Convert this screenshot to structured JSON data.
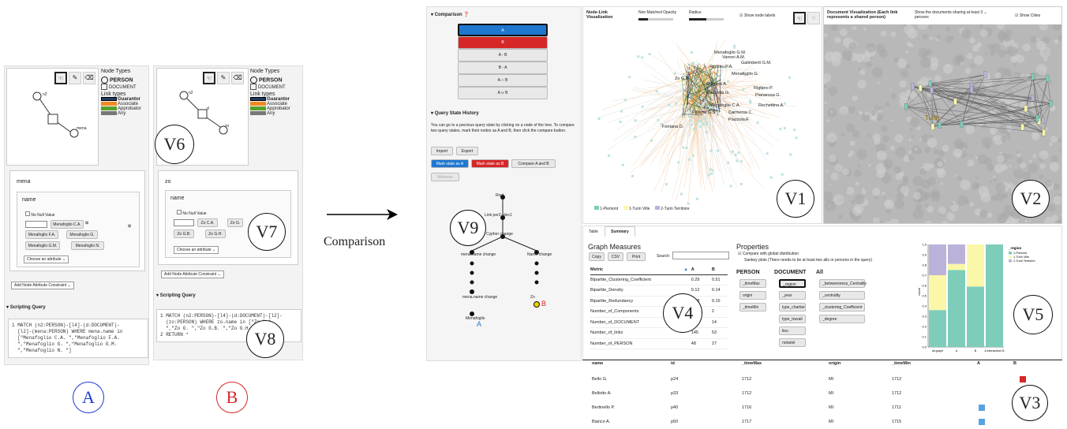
{
  "panelA": {
    "node_types_title": "Node Types",
    "type_person": "PERSON",
    "type_document": "DOCUMENT",
    "link_types_title": "Link types",
    "links": [
      "Guarantor",
      "Associate",
      "Approbator",
      "Any"
    ],
    "node_n2": "n2",
    "node_mena": "mena",
    "attr_name": "mena",
    "attr_field": "name",
    "no_null": "No Null Value",
    "chips": [
      "Menafoglio C.A.",
      "Menafoglio F.A.",
      "Menafoglio G.",
      "Menafoglio G.M.",
      "Menafoglio N."
    ],
    "choose": "Choose an attribute",
    "add_constraint": "Add Node Attribute Constraint",
    "scripting": "Scripting Query",
    "code": "1 MATCH (n2:PERSON)-[l4]-(d:DOCUMENT)-\n  [l2]-(mena:PERSON) WHERE mena.name in\n  [\"Menafoglio C.A. \",\"Menafoglio F.A.\n  \",\"Menafoglio G. \",\"Menafoglio G.M.\n  \",\"Menafoglio N. \"]",
    "label": "A"
  },
  "panelB": {
    "node_n2": "n2",
    "node_d": "d",
    "node_zo": "zo",
    "attr_name": "zo",
    "attr_field": "name",
    "no_null": "No Null Value",
    "chips": [
      "Zo C.A.",
      "Zo G.",
      "Zo G.B.",
      "Zo G.H."
    ],
    "choose": "Choose an attribute",
    "add_constraint": "Add Node Attribute Constraint",
    "scripting": "Scripting Query",
    "code": "1 MATCH (n2:PERSON)-[l4]-(d:DOCUMENT)-[l2]-\n  (zo:PERSON) WHERE zo.name in [\"Zo C.A.\n  \",\"Zo G. \",\"Zo G.B. \",\"Zo G.H.\n2 RETURN *",
    "label": "B"
  },
  "labels": {
    "v1": "V1",
    "v2": "V2",
    "v3": "V3",
    "v4": "V4",
    "v5": "V5",
    "v6": "V6",
    "v7": "V7",
    "v8": "V8",
    "v9": "V9"
  },
  "arrow_label": "Comparison",
  "comparison": {
    "title": "Comparison",
    "ops": [
      "A",
      "B",
      "A - B",
      "B - A",
      "A ∩ B",
      "A ∪ B"
    ],
    "history_title": "Query State History",
    "history_text": "You can go to a previous query state by clicking on a node of the tree. To compare two query states, mark their nodes as A and B, then click the compare button.",
    "import": "Import",
    "export": "Export",
    "mark_a": "Mark state as A",
    "mark_b": "Mark state as B",
    "compare": "Compare A and B",
    "minimize": "Minimize",
    "tree": {
      "root": "Root",
      "link": "Link per2--doc1",
      "cypher": "Cypher change",
      "mena1": "mena.name change",
      "name": "Name change",
      "mena2": "mena.name change",
      "zo": "Zo",
      "menafoglio": "Menafoglio",
      "a": "A",
      "b": "B"
    }
  },
  "nodelink": {
    "title": "Node-Link Visualization",
    "opacity": "Non Matched Opacity",
    "radius": "Radius",
    "show_labels": "Show node labels",
    "names": [
      "Menafoglio G.M.",
      "Vanoni A.M.",
      "Galimberti G.M.",
      "Righino P.A.",
      "Menafoglio G.",
      "Zo G.B.",
      "Cuigaris A.",
      "Righino P.",
      "Mascotta G.",
      "Pianarosa G.",
      "Menafoglio C.A.",
      "Rechettino A.",
      "Pistone G.S.",
      "Carmenia C.",
      "Piazzola F.",
      "Fontana D."
    ],
    "legend": [
      "1-Piemont",
      "1-Turin Ville",
      "2-Turin Territoire"
    ]
  },
  "docvis": {
    "title": "Document Visualization (Each link represents a shared person)",
    "show_docs": "Show the documents sharing at least",
    "docs_n": "3",
    "persons": "persons",
    "show_cities": "Show Cities",
    "city": "Turin"
  },
  "summary": {
    "tabs": [
      "Table",
      "Summary"
    ],
    "measures": "Graph Measures",
    "copy": "Copy",
    "csv": "CSV",
    "print": "Print",
    "search": "Search:",
    "cols": [
      "Metric",
      "A",
      "B"
    ],
    "rows": [
      [
        "Bipartite_Clustering_Coefficient",
        "0.29",
        "0.51"
      ],
      [
        "Bipartite_Density",
        "0.12",
        "0.14"
      ],
      [
        "Bipartite_Redundancy",
        "0.08",
        "0.15"
      ],
      [
        "Number_of_Components",
        "2",
        "2"
      ],
      [
        "Number_of_DOCUMENT",
        "21",
        "14"
      ],
      [
        "Number_of_links",
        "145",
        "53"
      ],
      [
        "Number_of_PERSON",
        "48",
        "27"
      ]
    ],
    "properties": "Properties",
    "compare_global": "Compare with global distribution",
    "sankey": "Sankey plots (There needs to be at least two alls or persons in the query)",
    "person": "PERSON",
    "document": "DOCUMENT",
    "all": "All",
    "person_props": [
      "_timeMax",
      "origin",
      "_timeMin"
    ],
    "doc_props": [
      "_region",
      "_year",
      "type_chartier",
      "type_travail",
      "lieu",
      "notariel"
    ],
    "all_props": [
      "_betweenness_Centrality",
      "_centrality",
      "_clustering_Coefficient",
      "_degree"
    ]
  },
  "chart_data": {
    "type": "bar",
    "categories": [
      "all-graph",
      "A",
      "B",
      "A intersection B"
    ],
    "series": [
      {
        "name": "1-Piemont",
        "values": [
          0.36,
          0.75,
          0.59,
          1.0
        ]
      },
      {
        "name": "1-Turin Ville",
        "values": [
          0.34,
          0.06,
          0.41,
          0.0
        ]
      },
      {
        "name": "2-Turin Territoire",
        "values": [
          0.3,
          0.19,
          0.0,
          0.0
        ]
      }
    ],
    "legend_title": "_region",
    "ylabel": "count",
    "ylim": [
      0,
      1.0
    ],
    "yticks": [
      "0.0",
      "0.1",
      "0.2",
      "0.3",
      "0.4",
      "0.5",
      "0.6",
      "0.7",
      "0.8",
      "0.9",
      "1.0"
    ],
    "colors": [
      "#7ecdbb",
      "#fbf7a8",
      "#bbb2d9"
    ]
  },
  "datatable": {
    "cols": [
      "name",
      "id",
      "_timeMax",
      "origin",
      "_timeMin",
      "A",
      "B"
    ],
    "rows": [
      [
        "Bello G.",
        "p24",
        "1712",
        "MI",
        "1712"
      ],
      [
        "Bellotto A.",
        "p33",
        "1712",
        "MI",
        "1712"
      ],
      [
        "Bertinello P.",
        "p40",
        "1716",
        "MI",
        "1711"
      ],
      [
        "Bianco A.",
        "p50",
        "1717",
        "MI",
        "1715"
      ]
    ]
  },
  "colors": {
    "guarantor": "#1f3a5f",
    "associate": "#f08a24",
    "approbator": "#5aa02c",
    "any": "#777",
    "a_blue": "#1f77d0",
    "b_red": "#d62728"
  }
}
